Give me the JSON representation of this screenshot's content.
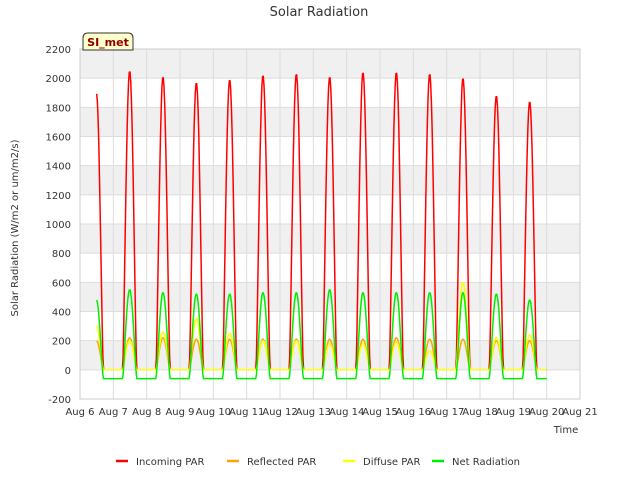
{
  "chart_data": {
    "type": "line",
    "title": "Solar Radiation",
    "xlabel": "Time",
    "ylabel": "Solar Radiation (W/m2 or um/m2/s)",
    "site_label": "SI_met",
    "xlim": [
      6,
      21
    ],
    "ylim": [
      -200,
      2200
    ],
    "x_ticks": [
      {
        "value": 6,
        "label": "Aug 6"
      },
      {
        "value": 7,
        "label": "Aug 7"
      },
      {
        "value": 8,
        "label": "Aug 8"
      },
      {
        "value": 9,
        "label": "Aug 9"
      },
      {
        "value": 10,
        "label": "Aug 10"
      },
      {
        "value": 11,
        "label": "Aug 11"
      },
      {
        "value": 12,
        "label": "Aug 12"
      },
      {
        "value": 13,
        "label": "Aug 13"
      },
      {
        "value": 14,
        "label": "Aug 14"
      },
      {
        "value": 15,
        "label": "Aug 15"
      },
      {
        "value": 16,
        "label": "Aug 16"
      },
      {
        "value": 17,
        "label": "Aug 17"
      },
      {
        "value": 18,
        "label": "Aug 18"
      },
      {
        "value": 19,
        "label": "Aug 19"
      },
      {
        "value": 20,
        "label": "Aug 20"
      },
      {
        "value": 21,
        "label": "Aug 21"
      }
    ],
    "y_ticks": [
      -200,
      0,
      200,
      400,
      600,
      800,
      1000,
      1200,
      1400,
      1600,
      1800,
      2000,
      2200
    ],
    "grid": true,
    "legend_position": "bottom",
    "x_start": 6.5,
    "x_end": 20.0,
    "series": [
      {
        "name": "Incoming PAR",
        "color": "#ff0000",
        "night_value": 0,
        "daily_peaks": [
          1900,
          2050,
          2010,
          1970,
          1990,
          2020,
          2030,
          2010,
          2040,
          2040,
          2030,
          2000,
          1880,
          1840
        ]
      },
      {
        "name": "Reflected PAR",
        "color": "#ffa500",
        "night_value": 0,
        "daily_peaks": [
          200,
          220,
          220,
          210,
          210,
          210,
          210,
          210,
          210,
          220,
          210,
          210,
          200,
          200
        ]
      },
      {
        "name": "Diffuse PAR",
        "color": "#ffff00",
        "night_value": 0,
        "daily_peaks": [
          300,
          200,
          260,
          350,
          250,
          200,
          200,
          180,
          180,
          190,
          130,
          600,
          220,
          240
        ]
      },
      {
        "name": "Net Radiation",
        "color": "#00ee00",
        "night_value": -60,
        "daily_peaks": [
          480,
          550,
          530,
          520,
          520,
          530,
          530,
          550,
          530,
          530,
          530,
          530,
          520,
          480
        ]
      }
    ]
  }
}
